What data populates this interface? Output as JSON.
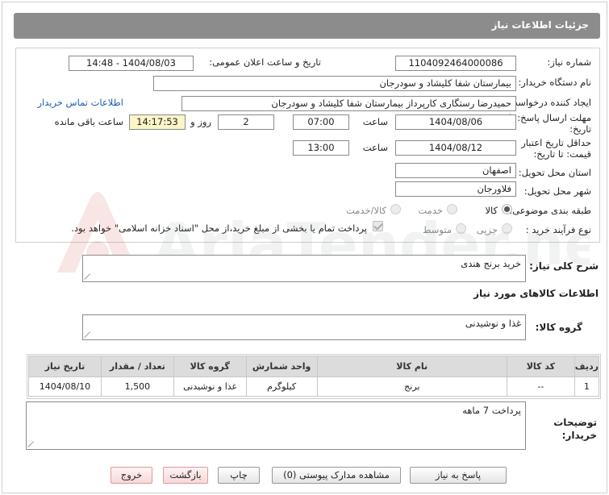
{
  "header": {
    "title": "جزئیات اطلاعات نیاز"
  },
  "form": {
    "need_number_label": "شماره نیاز:",
    "need_number": "1104092464000086",
    "announce_label": "تاریخ و ساعت اعلان عمومی:",
    "announce_value": "1404/08/03 - 14:48",
    "buyer_label": "نام دستگاه خریدار:",
    "buyer_value": "بیمارستان شفا کلیشاد و سودرجان",
    "creator_label": "ایجاد کننده درخواست:",
    "creator_value": "حمیدرضا رستگاری کارپرداز بیمارستان شفا کلیشاد و سودرجان",
    "contact_link": "اطلاعات تماس خریدار",
    "deadline_label_1": "مهلت ارسال پاسخ: تا",
    "deadline_label_2": "تاریخ:",
    "deadline_date": "1404/08/06",
    "time_label": "ساعت",
    "deadline_time": "07:00",
    "days_value": "2",
    "days_label": "روز و",
    "remaining_time": "14:17:53",
    "remaining_label": "ساعت باقی مانده",
    "validity_label_1": "حداقل تاریخ اعتبار",
    "validity_label_2": "قیمت: تا تاریخ:",
    "validity_date": "1404/08/12",
    "validity_time": "13:00",
    "province_label": "استان محل تحویل:",
    "province_value": "اصفهان",
    "city_label": "شهر محل تحویل:",
    "city_value": "فلاورجان",
    "category_label": "طبقه بندی موضوعی:",
    "category_options": [
      "کالا",
      "خدمت",
      "کالا/خدمت"
    ],
    "category_selected": 0,
    "process_label": "نوع فرآیند خرید :",
    "process_options": [
      "جزیی",
      "متوسط"
    ],
    "process_selected": 0,
    "payment_note": "پرداخت تمام یا بخشی از مبلغ خرید،از محل \"اسناد خزانه اسلامی\" خواهد بود."
  },
  "summary": {
    "label": "شرح کلی نیاز:",
    "value": "خرید برنج هندی"
  },
  "goods": {
    "section_title": "اطلاعات کالاهای مورد نیاز",
    "group_label": "گروه کالا:",
    "group_value": "غذا و نوشیدنی",
    "columns": [
      "ردیف",
      "کد کالا",
      "نام کالا",
      "واحد شمارش",
      "گروه کالا",
      "تعداد / مقدار",
      "تاریخ نیاز"
    ],
    "rows": [
      [
        "1",
        "--",
        "برنج",
        "کیلوگرم",
        "غذا و نوشیدنی",
        "1,500",
        "1404/08/10"
      ]
    ]
  },
  "buyer_notes": {
    "label_1": "توضیحات",
    "label_2": "خریدار:",
    "value": "پرداخت 7 ماهه"
  },
  "buttons": {
    "reply": "پاسخ به نیاز",
    "docs": "مشاهده مدارک پیوستی (0)",
    "print": "چاپ",
    "back": "بازگشت",
    "exit": "خروج"
  },
  "colors": {
    "header_bg": "#8c8c8c",
    "link": "#1a5fb4",
    "highlight": "#fbf5c8"
  }
}
